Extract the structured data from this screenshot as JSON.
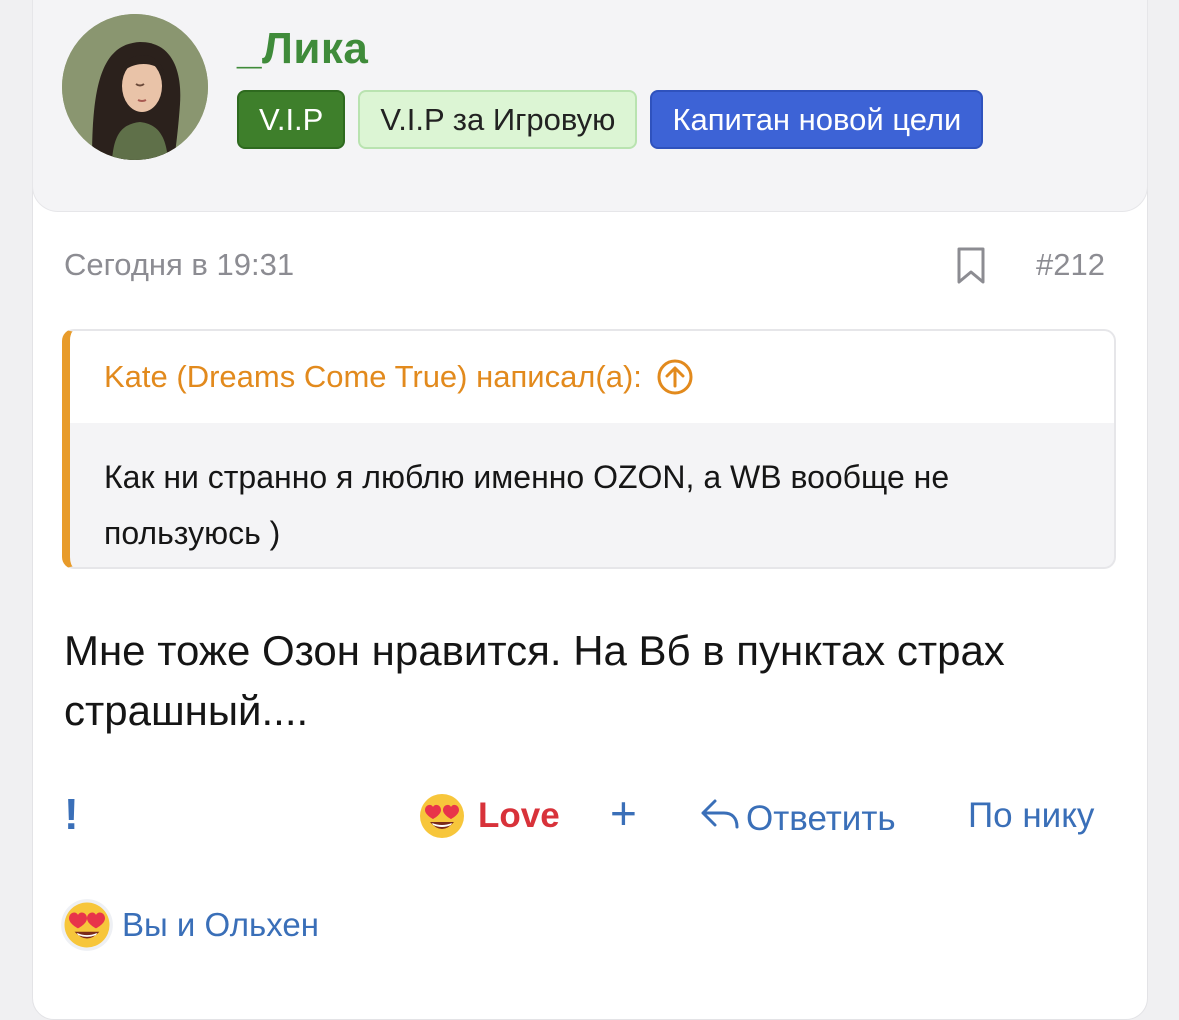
{
  "user": {
    "name": "_Лика",
    "avatar_icon": "woman-portrait-avatar"
  },
  "badges": [
    {
      "label": "V.I.P",
      "color": "#3e7f2b"
    },
    {
      "label": "V.I.P за Игровую",
      "color": "#dcf5d4"
    },
    {
      "label": "Капитан новой цели",
      "color": "#3d63d6"
    }
  ],
  "post": {
    "date": "Сегодня в 19:31",
    "number": "#212",
    "bookmark_icon": "bookmark-icon"
  },
  "quote": {
    "author_line": "Kate (Dreams Come True) написал(а):",
    "text": "Как ни странно я люблю именно OZON, а WB вообще не пользуюсь )",
    "accent": "#e89b2a"
  },
  "message": {
    "text": "Мне тоже Озон нравится. На Вб в пунктах страх страшный...."
  },
  "actions": {
    "report": "!",
    "love": "Love",
    "add": "+",
    "reply": "Ответить",
    "by_nick": "По нику"
  },
  "reactions": {
    "summary": "Вы и Ольхен",
    "emoji": "heart-eyes-icon"
  }
}
